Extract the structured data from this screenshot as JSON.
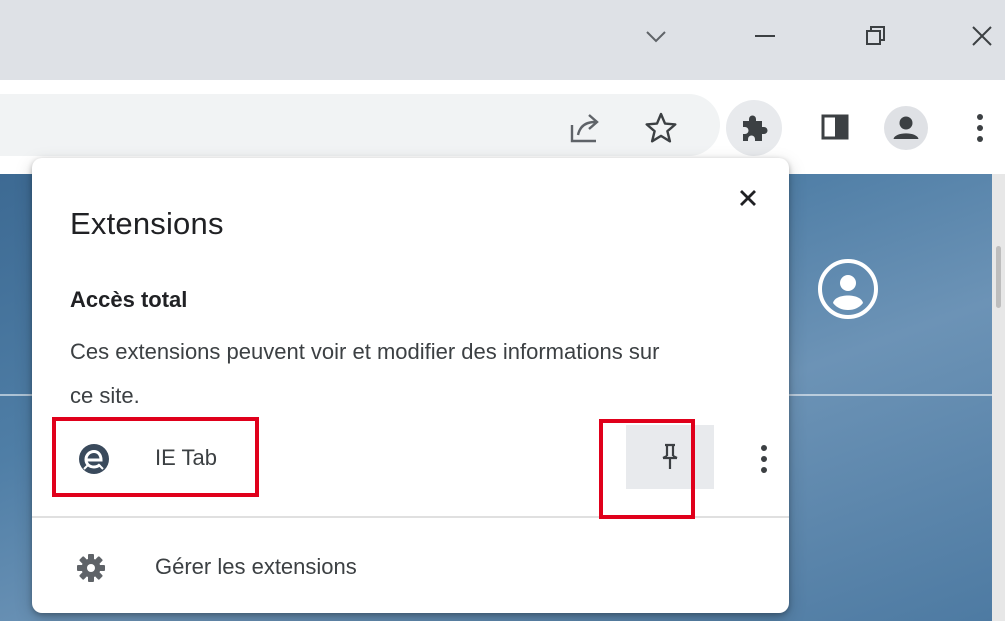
{
  "window": {
    "controls": [
      {
        "name": "tab-search",
        "icon": "chevron-down-icon"
      },
      {
        "name": "minimize",
        "icon": "minimize-icon"
      },
      {
        "name": "restore",
        "icon": "restore-icon"
      },
      {
        "name": "close",
        "icon": "close-icon"
      }
    ]
  },
  "toolbar": {
    "icons": [
      "share-icon",
      "bookmark-star-icon",
      "puzzle-icon",
      "side-panel-icon",
      "profile-icon",
      "kebab-menu-icon"
    ]
  },
  "extensions_popup": {
    "title": "Extensions",
    "section_heading": "Accès total",
    "section_description": "Ces extensions peuvent voir et modifier des informations sur ce site.",
    "extensions": [
      {
        "name": "IE Tab",
        "icon": "ie-tab-logo-icon",
        "pinned": false
      }
    ],
    "manage_label": "Gérer les extensions"
  },
  "colors": {
    "annotation": "#e0001b",
    "titlebar": "#dee1e6",
    "page_background": "#4f7ea6",
    "text_primary": "#202124"
  }
}
